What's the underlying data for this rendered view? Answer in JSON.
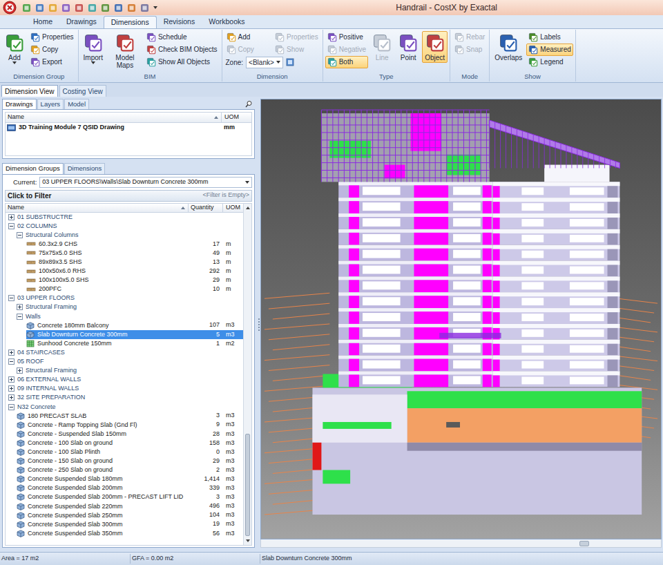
{
  "window": {
    "title": "Handrail - CostX by Exactal"
  },
  "ribbon": {
    "tabs": [
      {
        "label": "Home",
        "selected": false
      },
      {
        "label": "Drawings",
        "selected": false
      },
      {
        "label": "Dimensions",
        "selected": true
      },
      {
        "label": "Revisions",
        "selected": false
      },
      {
        "label": "Workbooks",
        "selected": false
      }
    ],
    "groups": [
      {
        "title": "Dimension Group",
        "items": [
          {
            "kind": "large",
            "label": "Add",
            "dropdown": true,
            "disabled": false,
            "selected": false
          },
          {
            "kind": "column",
            "buttons": [
              {
                "label": "Properties",
                "disabled": false,
                "selected": false
              },
              {
                "label": "Copy",
                "disabled": false,
                "selected": false
              },
              {
                "label": "Export",
                "disabled": false,
                "selected": false
              }
            ]
          }
        ]
      },
      {
        "title": "BIM",
        "items": [
          {
            "kind": "large",
            "label": "Import",
            "dropdown": true,
            "disabled": false,
            "selected": false
          },
          {
            "kind": "large",
            "label": "Model Maps",
            "dropdown": false,
            "disabled": false,
            "selected": false
          },
          {
            "kind": "column",
            "buttons": [
              {
                "label": "Schedule",
                "disabled": false,
                "selected": false
              },
              {
                "label": "Check BIM Objects",
                "disabled": false,
                "selected": false
              },
              {
                "label": "Show All Objects",
                "disabled": false,
                "selected": false
              }
            ]
          }
        ]
      },
      {
        "title": "Dimension",
        "items": [
          {
            "kind": "grid",
            "buttons": [
              {
                "label": "Add",
                "disabled": false,
                "selected": false
              },
              {
                "label": "Properties",
                "disabled": true,
                "selected": false
              },
              {
                "label": "Copy",
                "disabled": true,
                "selected": false
              },
              {
                "label": "Show",
                "disabled": true,
                "selected": false
              }
            ],
            "field": {
              "label": "Zone:",
              "value": "<Blank>"
            }
          }
        ]
      },
      {
        "title": "Type",
        "items": [
          {
            "kind": "column",
            "buttons": [
              {
                "label": "Positive",
                "disabled": false,
                "selected": false
              },
              {
                "label": "Negative",
                "disabled": true,
                "selected": false
              },
              {
                "label": "Both",
                "disabled": false,
                "selected": true
              }
            ]
          },
          {
            "kind": "large",
            "label": "Line",
            "dropdown": false,
            "disabled": true,
            "selected": false
          },
          {
            "kind": "large",
            "label": "Point",
            "dropdown": false,
            "disabled": false,
            "selected": false
          },
          {
            "kind": "large",
            "label": "Object",
            "dropdown": false,
            "disabled": false,
            "selected": true
          }
        ]
      },
      {
        "title": "Mode",
        "items": [
          {
            "kind": "column",
            "buttons": [
              {
                "label": "Rebar",
                "disabled": true,
                "selected": false
              },
              {
                "label": "Snap",
                "disabled": true,
                "selected": false
              }
            ]
          }
        ]
      },
      {
        "title": "Show",
        "items": [
          {
            "kind": "large",
            "label": "Overlaps",
            "dropdown": false,
            "disabled": false,
            "selected": false
          },
          {
            "kind": "column",
            "buttons": [
              {
                "label": "Labels",
                "disabled": false,
                "selected": false
              },
              {
                "label": "Measured",
                "disabled": false,
                "selected": true
              },
              {
                "label": "Legend",
                "disabled": false,
                "selected": false
              }
            ]
          }
        ]
      }
    ]
  },
  "view_tabs": [
    {
      "label": "Dimension View",
      "selected": true
    },
    {
      "label": "Costing View",
      "selected": false
    }
  ],
  "panel_tabs": [
    {
      "label": "Drawings",
      "selected": true
    },
    {
      "label": "Layers",
      "selected": false
    },
    {
      "label": "Model",
      "selected": false
    }
  ],
  "drawings_table": {
    "columns": [
      "Name",
      "UOM"
    ],
    "rows": [
      {
        "name": "3D Training Module 7 QSID Drawing",
        "uom": "mm",
        "selected": false
      }
    ]
  },
  "dimension_tabs": [
    {
      "label": "Dimension Groups",
      "selected": true
    },
    {
      "label": "Dimensions",
      "selected": false
    }
  ],
  "current": {
    "label": "Current:",
    "value": "03 UPPER FLOORS\\Walls\\Slab Downturn Concrete 300mm"
  },
  "filter": {
    "label": "Click to Filter",
    "status": "<Filter is Empty>"
  },
  "tree": {
    "columns": [
      "Name",
      "Quantity",
      "UOM"
    ],
    "rows": [
      {
        "name": "01 SUBSTRUCTRE",
        "kind": "group",
        "depth": 0,
        "expanded": false,
        "selected": false
      },
      {
        "name": "02 COLUMNS",
        "kind": "group",
        "depth": 0,
        "expanded": true,
        "selected": false
      },
      {
        "name": "Structural Columns",
        "kind": "group",
        "depth": 1,
        "expanded": true,
        "selected": false
      },
      {
        "name": "60.3x2.9 CHS",
        "kind": "item",
        "depth": 2,
        "quantity": "17",
        "uom": "m",
        "selected": false
      },
      {
        "name": "75x75x5.0 SHS",
        "kind": "item",
        "depth": 2,
        "quantity": "49",
        "uom": "m",
        "selected": false
      },
      {
        "name": "89x89x3.5 SHS",
        "kind": "item",
        "depth": 2,
        "quantity": "13",
        "uom": "m",
        "selected": false
      },
      {
        "name": "100x50x6.0 RHS",
        "kind": "item",
        "depth": 2,
        "quantity": "292",
        "uom": "m",
        "selected": false
      },
      {
        "name": "100x100x5.0 SHS",
        "kind": "item",
        "depth": 2,
        "quantity": "29",
        "uom": "m",
        "selected": false
      },
      {
        "name": "200PFC",
        "kind": "item",
        "depth": 2,
        "quantity": "10",
        "uom": "m",
        "selected": false
      },
      {
        "name": "03 UPPER FLOORS",
        "kind": "group",
        "depth": 0,
        "expanded": true,
        "selected": false
      },
      {
        "name": "Structural Framing",
        "kind": "group",
        "depth": 1,
        "expanded": false,
        "selected": false
      },
      {
        "name": "Walls",
        "kind": "group",
        "depth": 1,
        "expanded": true,
        "selected": false
      },
      {
        "name": "Concrete 180mm Balcony",
        "kind": "item",
        "depth": 2,
        "quantity": "107",
        "uom": "m3",
        "selected": false
      },
      {
        "name": "Slab Downturn Concrete 300mm",
        "kind": "item",
        "depth": 2,
        "quantity": "5",
        "uom": "m3",
        "selected": true
      },
      {
        "name": "Sunhood Concrete 150mm",
        "kind": "item",
        "depth": 2,
        "quantity": "1",
        "uom": "m2",
        "selected": false
      },
      {
        "name": "04 STAIRCASES",
        "kind": "group",
        "depth": 0,
        "expanded": false,
        "selected": false
      },
      {
        "name": "05 ROOF",
        "kind": "group",
        "depth": 0,
        "expanded": true,
        "selected": false
      },
      {
        "name": "Structural Framing",
        "kind": "group",
        "depth": 1,
        "expanded": false,
        "selected": false
      },
      {
        "name": "06 EXTERNAL WALLS",
        "kind": "group",
        "depth": 0,
        "expanded": false,
        "selected": false
      },
      {
        "name": "09 INTERNAL WALLS",
        "kind": "group",
        "depth": 0,
        "expanded": false,
        "selected": false
      },
      {
        "name": "32 SITE PREPARATION",
        "kind": "group",
        "depth": 0,
        "expanded": false,
        "selected": false
      },
      {
        "name": "N32 Concrete",
        "kind": "group",
        "depth": 0,
        "expanded": true,
        "selected": false
      },
      {
        "name": "180 PRECAST SLAB",
        "kind": "item",
        "depth": 1,
        "quantity": "3",
        "uom": "m3",
        "selected": false
      },
      {
        "name": "Concrete - Ramp Topping Slab (Gnd Fl)",
        "kind": "item",
        "depth": 1,
        "quantity": "9",
        "uom": "m3",
        "selected": false
      },
      {
        "name": "Concrete -  Suspended Slab 150mm",
        "kind": "item",
        "depth": 1,
        "quantity": "28",
        "uom": "m3",
        "selected": false
      },
      {
        "name": "Concrete - 100 Slab on ground",
        "kind": "item",
        "depth": 1,
        "quantity": "158",
        "uom": "m3",
        "selected": false
      },
      {
        "name": "Concrete - 100 Slab Plinth",
        "kind": "item",
        "depth": 1,
        "quantity": "0",
        "uom": "m3",
        "selected": false
      },
      {
        "name": "Concrete - 150 Slab on ground",
        "kind": "item",
        "depth": 1,
        "quantity": "29",
        "uom": "m3",
        "selected": false
      },
      {
        "name": "Concrete - 250 Slab on ground",
        "kind": "item",
        "depth": 1,
        "quantity": "2",
        "uom": "m3",
        "selected": false
      },
      {
        "name": "Concrete Suspended Slab 180mm",
        "kind": "item",
        "depth": 1,
        "quantity": "1,414",
        "uom": "m3",
        "selected": false
      },
      {
        "name": "Concrete Suspended Slab 200mm",
        "kind": "item",
        "depth": 1,
        "quantity": "339",
        "uom": "m3",
        "selected": false
      },
      {
        "name": "Concrete Suspended Slab 200mm - PRECAST LIFT LID",
        "kind": "item",
        "depth": 1,
        "quantity": "3",
        "uom": "m3",
        "selected": false
      },
      {
        "name": "Concrete Suspended Slab 220mm",
        "kind": "item",
        "depth": 1,
        "quantity": "496",
        "uom": "m3",
        "selected": false
      },
      {
        "name": "Concrete Suspended Slab 250mm",
        "kind": "item",
        "depth": 1,
        "quantity": "104",
        "uom": "m3",
        "selected": false
      },
      {
        "name": "Concrete Suspended Slab 300mm",
        "kind": "item",
        "depth": 1,
        "quantity": "19",
        "uom": "m3",
        "selected": false
      },
      {
        "name": "Concrete Suspended Slab 350mm",
        "kind": "item",
        "depth": 1,
        "quantity": "56",
        "uom": "m3",
        "selected": false
      }
    ]
  },
  "status_bar": [
    "Area = 17 m2",
    "GFA = 0.00 m2",
    "Slab Downturn Concrete 300mm"
  ]
}
